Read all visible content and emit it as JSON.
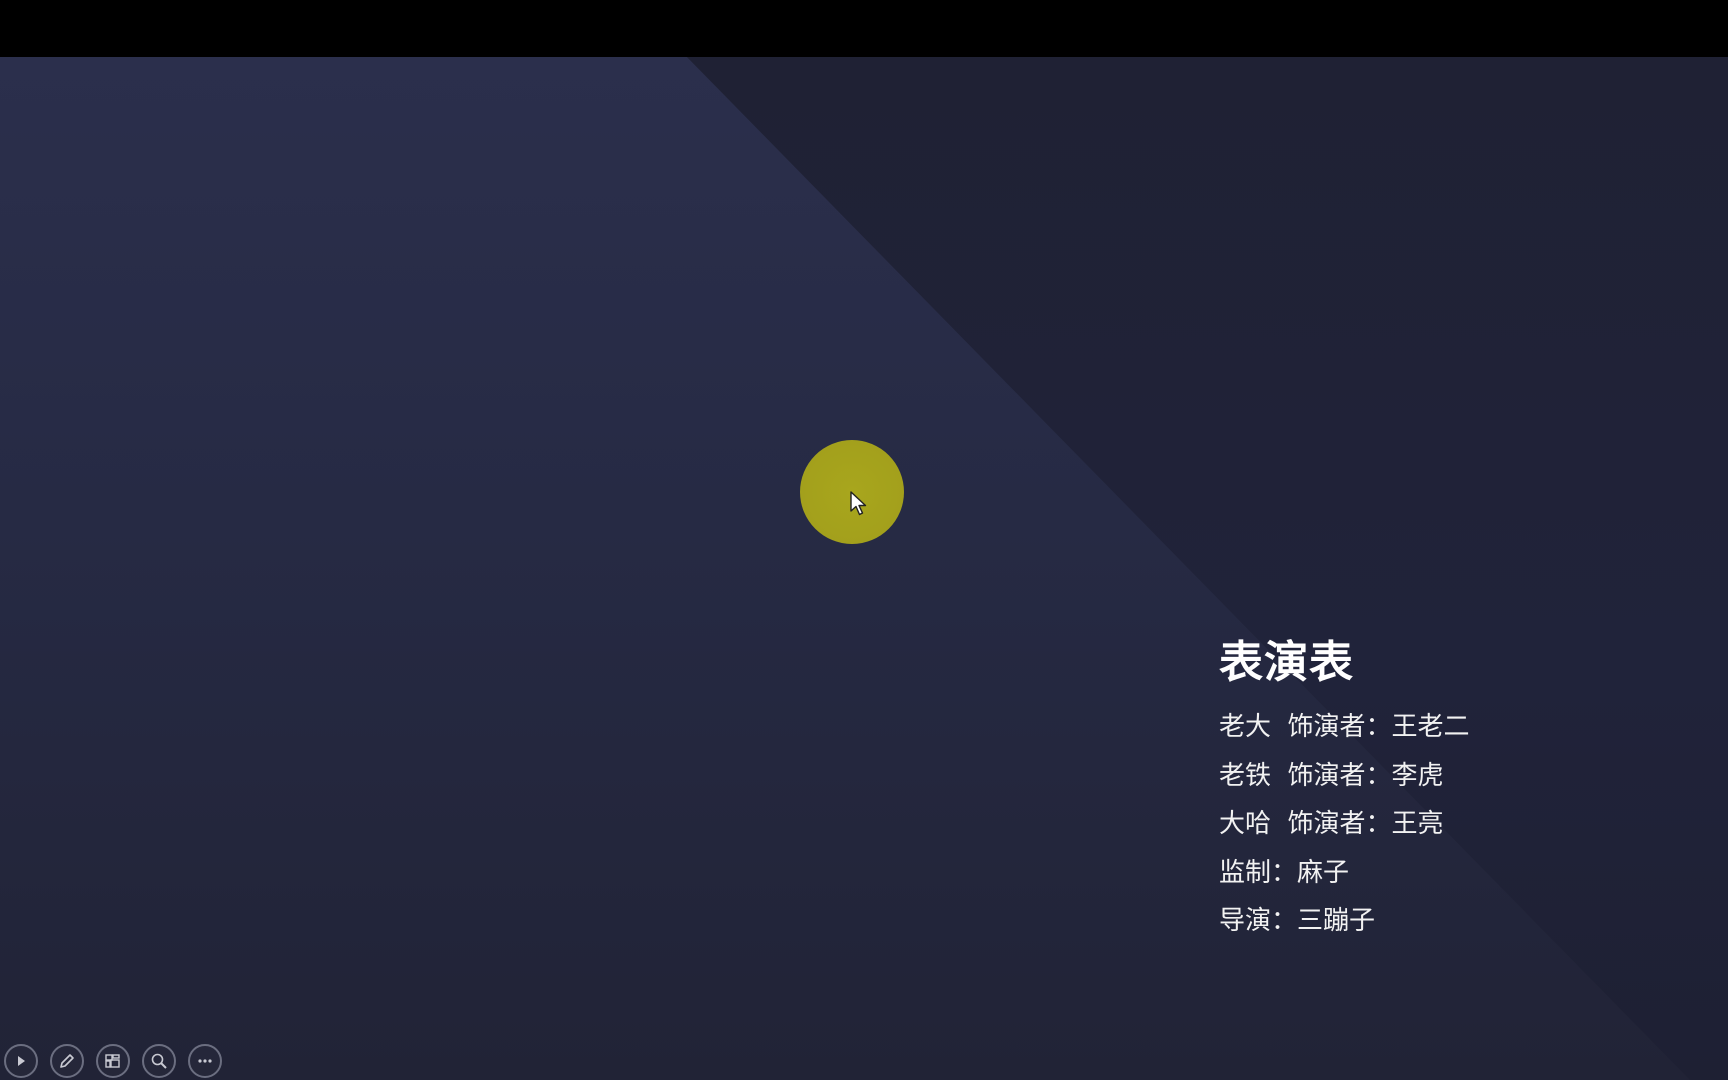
{
  "slide": {
    "title": "表演表",
    "lines": [
      "老大  饰演者：王老二",
      "老铁  饰演者：李虎",
      "大哈  饰演者：王亮",
      "监制：麻子",
      "导演：三蹦子"
    ]
  },
  "controls": [
    {
      "name": "play-icon"
    },
    {
      "name": "pen-icon"
    },
    {
      "name": "slides-overview-icon"
    },
    {
      "name": "zoom-icon"
    },
    {
      "name": "more-icon"
    }
  ],
  "colors": {
    "highlight": "#a8a61d",
    "slide_bg": "#262a44",
    "text": "#ffffff"
  }
}
